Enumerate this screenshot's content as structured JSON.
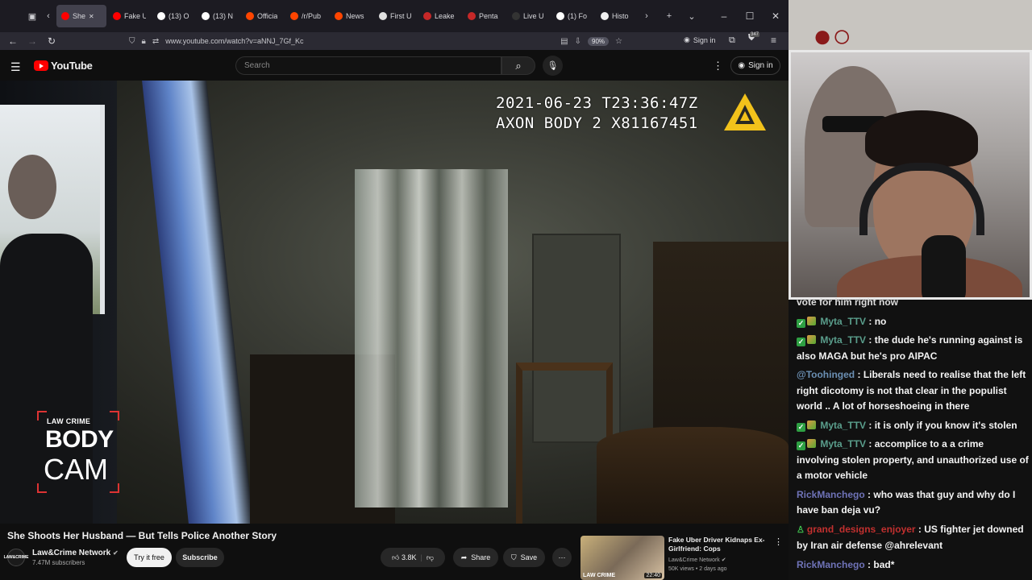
{
  "browser": {
    "tabs": [
      {
        "label": "She",
        "favicon": "#ff0000",
        "active": true
      },
      {
        "label": "Fake U",
        "favicon": "#ff0000"
      },
      {
        "label": "(13) O",
        "favicon": "#ffffff"
      },
      {
        "label": "(13) N",
        "favicon": "#ffffff"
      },
      {
        "label": "Officia",
        "favicon": "#ff4500"
      },
      {
        "label": "/r/Pub",
        "favicon": "#ff4500"
      },
      {
        "label": "News",
        "favicon": "#ff4500"
      },
      {
        "label": "First U",
        "favicon": "#e0e0e0"
      },
      {
        "label": "Leake",
        "favicon": "#c62828"
      },
      {
        "label": "Penta",
        "favicon": "#c62828"
      },
      {
        "label": "Live U",
        "favicon": "#333333"
      },
      {
        "label": "(1) Fo",
        "favicon": "#ffffff"
      },
      {
        "label": "Histo",
        "favicon": "#f0f0f0"
      }
    ],
    "url": "www.youtube.com/watch?v=aNNJ_7Gf_Kc",
    "zoom": "90%",
    "signin_label": "Sign in",
    "ext_badge": "347"
  },
  "youtube": {
    "logo_text": "YouTube",
    "search_placeholder": "Search",
    "signin_label": "Sign in"
  },
  "video": {
    "timestamp_line1": "2021-06-23 T23:36:47Z",
    "timestamp_line2": "AXON BODY 2 X81167451",
    "overlay_small": "LAW CRIME",
    "overlay_body": "BODY",
    "overlay_cam": "CAM",
    "title": "She Shoots Her Husband — But Tells Police Another Story"
  },
  "channel": {
    "avatar_text": "LAW&CRIME",
    "name": "Law&Crime Network",
    "subscribers": "7.47M subscribers",
    "try_free": "Try it free",
    "subscribe": "Subscribe"
  },
  "actions": {
    "likes": "3.8K",
    "share": "Share",
    "save": "Save"
  },
  "recommended": {
    "title": "Fake Uber Driver Kidnaps Ex-Girlfriend: Cops",
    "channel": "Law&Crime Network",
    "meta": "50K views • 2 days ago",
    "duration": "22:40",
    "thumb_brand": "LAW CRIME"
  },
  "chat": {
    "messages": [
      {
        "user": "",
        "text": "vote for him right now",
        "badges": false,
        "color": "#f4f4f4"
      },
      {
        "user": "Myta_TTV",
        "text": "no",
        "badges": true,
        "color": "#5a9e8c"
      },
      {
        "user": "Myta_TTV",
        "text": "the dude he's running against is also MAGA but he's pro AIPAC",
        "badges": true,
        "color": "#5a9e8c"
      },
      {
        "user": "@Toohinged",
        "text": "Liberals need to realise that the left right dicotomy is not that clear in the populist world .. A lot of horseshoeing in there",
        "badges": false,
        "color": "#6b8fb3"
      },
      {
        "user": "Myta_TTV",
        "text": "it is only if you know it's stolen",
        "badges": true,
        "color": "#5a9e8c"
      },
      {
        "user": "Myta_TTV",
        "text": "accomplice to a a crime involving stolen property, and unauthorized use of a motor vehicle",
        "badges": true,
        "color": "#5a9e8c"
      },
      {
        "user": "RickManchego",
        "text": "who was that guy and why do I have ban deja vu?",
        "badges": false,
        "color": "#6f73b8"
      },
      {
        "user": "grand_designs_enjoyer",
        "text": "US fighter jet downed by Iran air defense @ahrelevant",
        "badges": false,
        "person": true,
        "color": "#c2302f"
      },
      {
        "user": "RickManchego",
        "text": "bad*",
        "badges": false,
        "color": "#6f73b8"
      }
    ]
  }
}
